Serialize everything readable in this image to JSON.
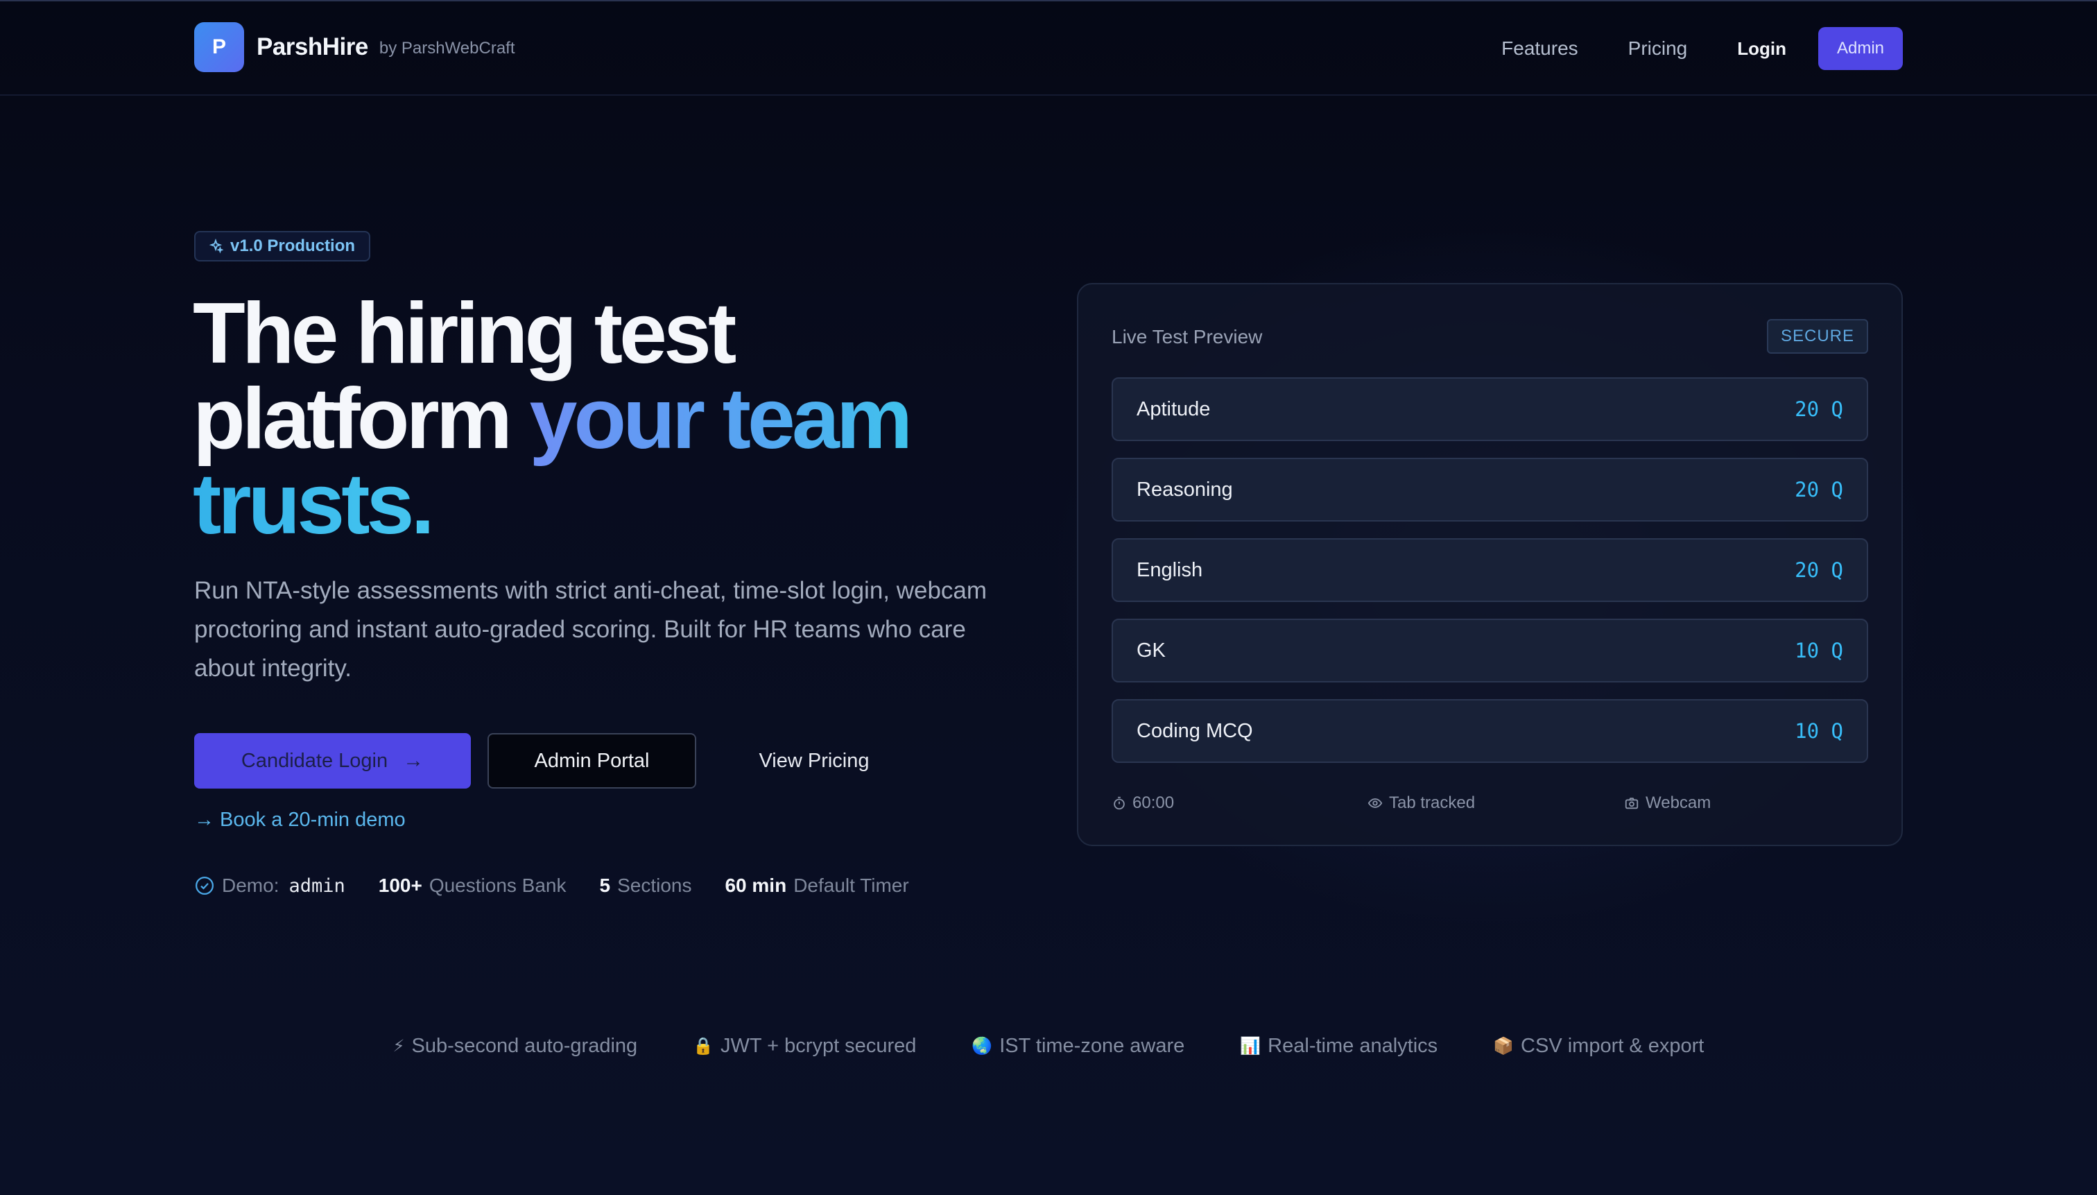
{
  "nav": {
    "logo_letter": "P",
    "brand": "ParshHire",
    "by": "by ParshWebCraft",
    "links": [
      "Features",
      "Pricing"
    ],
    "login": "Login",
    "admin": "Admin"
  },
  "hero": {
    "badge": "v1.0 Production",
    "headline_part1": "The hiring test",
    "headline_part2": "platform ",
    "headline_highlight": "your team",
    "headline_part3": "trusts.",
    "lede": "Run NTA-style assessments with strict anti-cheat, time-slot login, webcam proctoring and instant auto-graded scoring. Built for HR teams who care about integrity.",
    "primary_cta": "Candidate Login",
    "secondary_cta": "Admin Portal",
    "tertiary_cta": "View Pricing",
    "demo_link": "→ Book a 20-min demo",
    "stats": {
      "demo_label": "Demo:",
      "demo_value": "admin",
      "questions_value": "100+",
      "questions_label": "Questions Bank",
      "sections_value": "5",
      "sections_label": "Sections",
      "timer_value": "60 min",
      "timer_label": "Default Timer"
    }
  },
  "preview": {
    "title": "Live Test Preview",
    "badge": "SECURE",
    "sections": [
      {
        "label": "Aptitude",
        "count": "20 Q"
      },
      {
        "label": "Reasoning",
        "count": "20 Q"
      },
      {
        "label": "English",
        "count": "20 Q"
      },
      {
        "label": "GK",
        "count": "10 Q"
      },
      {
        "label": "Coding MCQ",
        "count": "10 Q"
      }
    ],
    "footer": {
      "timer": "60:00",
      "tab": "Tab tracked",
      "webcam": "Webcam"
    }
  },
  "features": [
    {
      "icon": "⚡",
      "label": "Sub-second auto-grading"
    },
    {
      "icon": "🔒",
      "label": "JWT + bcrypt secured"
    },
    {
      "icon": "🌏",
      "label": "IST time-zone aware"
    },
    {
      "icon": "📊",
      "label": "Real-time analytics"
    },
    {
      "icon": "📦",
      "label": "CSV import & export"
    }
  ],
  "colors": {
    "accent": "#4f46e5",
    "highlight": "#38bdf8",
    "background": "#070b1a"
  }
}
